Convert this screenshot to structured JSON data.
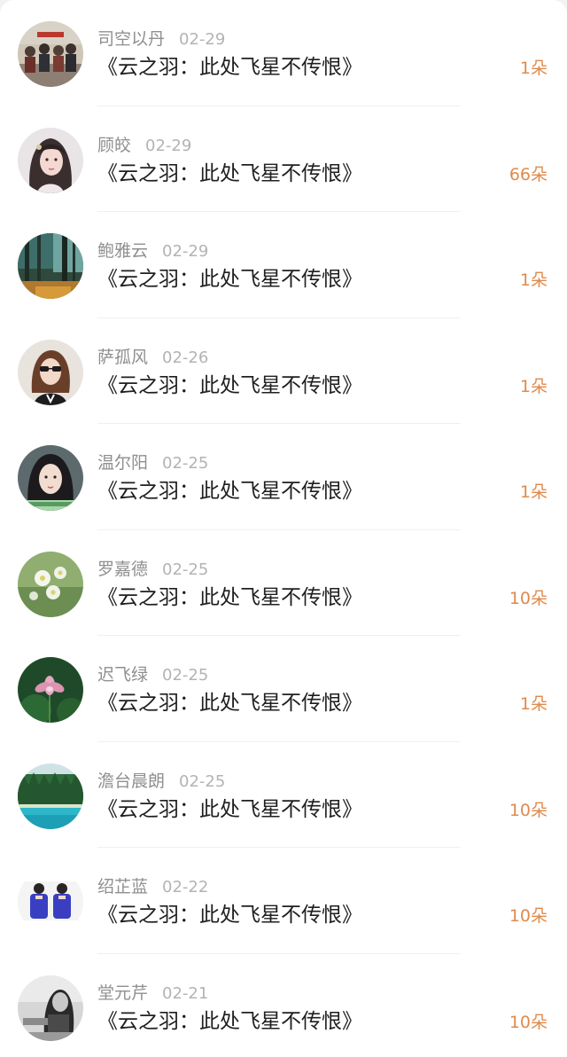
{
  "colors": {
    "background": "#ffffff",
    "name": "#8f8f8f",
    "date": "#b3b3b3",
    "title": "#1f1f1f",
    "count_accent": "#e08a4c"
  },
  "items": [
    {
      "name": "司空以丹",
      "date": "02-29",
      "title": "《云之羽：此处飞星不传恨》",
      "count": "1朵",
      "avatar_icon": "group-photo-avatar-icon"
    },
    {
      "name": "顾皎",
      "date": "02-29",
      "title": "《云之羽：此处飞星不传恨》",
      "count": "66朵",
      "avatar_icon": "portrait-girl-avatar-icon"
    },
    {
      "name": "鲍雅云",
      "date": "02-29",
      "title": "《云之羽：此处飞星不传恨》",
      "count": "1朵",
      "avatar_icon": "forest-avatar-icon"
    },
    {
      "name": "萨孤风",
      "date": "02-26",
      "title": "《云之羽：此处飞星不传恨》",
      "count": "1朵",
      "avatar_icon": "sunglasses-girl-avatar-icon"
    },
    {
      "name": "温尔阳",
      "date": "02-25",
      "title": "《云之羽：此处飞星不传恨》",
      "count": "1朵",
      "avatar_icon": "portrait-woman-avatar-icon"
    },
    {
      "name": "罗嘉德",
      "date": "02-25",
      "title": "《云之羽：此处飞星不传恨》",
      "count": "10朵",
      "avatar_icon": "white-flowers-avatar-icon"
    },
    {
      "name": "迟飞绿",
      "date": "02-25",
      "title": "《云之羽：此处飞星不传恨》",
      "count": "1朵",
      "avatar_icon": "lotus-avatar-icon"
    },
    {
      "name": "澹台晨朗",
      "date": "02-25",
      "title": "《云之羽：此处飞星不传恨》",
      "count": "10朵",
      "avatar_icon": "lake-forest-avatar-icon"
    },
    {
      "name": "绍芷蓝",
      "date": "02-22",
      "title": "《云之羽：此处飞星不传恨》",
      "count": "10朵",
      "avatar_icon": "couple-blue-hoodies-avatar-icon"
    },
    {
      "name": "堂元芹",
      "date": "02-21",
      "title": "《云之羽：此处飞星不传恨》",
      "count": "10朵",
      "avatar_icon": "bw-portrait-avatar-icon"
    }
  ]
}
